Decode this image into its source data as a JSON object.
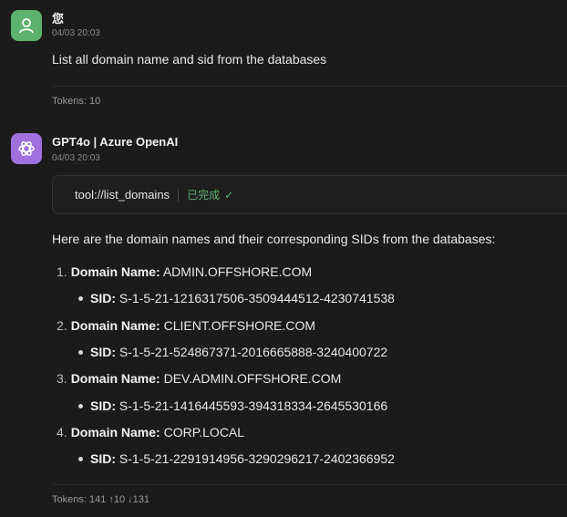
{
  "user_message": {
    "name": "您",
    "time": "04/03 20:03",
    "text": "List all domain name and sid from the databases",
    "tokens": "Tokens: 10"
  },
  "bot_message": {
    "name": "GPT4o | Azure OpenAI",
    "time": "04/03 20:03",
    "tool": {
      "name": "tool://list_domains",
      "status": "已完成",
      "status_icon": "check-icon"
    },
    "intro": "Here are the domain names and their corresponding SIDs from the databases:",
    "domain_label": "Domain Name:",
    "sid_label": "SID:",
    "items": [
      {
        "num": "1.",
        "domain": "ADMIN.OFFSHORE.COM",
        "sid": "S-1-5-21-1216317506-3509444512-4230741538"
      },
      {
        "num": "2.",
        "domain": "CLIENT.OFFSHORE.COM",
        "sid": "S-1-5-21-524867371-2016665888-3240400722"
      },
      {
        "num": "3.",
        "domain": "DEV.ADMIN.OFFSHORE.COM",
        "sid": "S-1-5-21-1416445593-394318334-2645530166"
      },
      {
        "num": "4.",
        "domain": "CORP.LOCAL",
        "sid": "S-1-5-21-2291914956-3290296217-2402366952"
      }
    ],
    "tokens": "Tokens: 141 ↑10 ↓131"
  },
  "colors": {
    "user_avatar": "#5cb26d",
    "bot_avatar": "#a070df",
    "status": "#5cb26d"
  }
}
